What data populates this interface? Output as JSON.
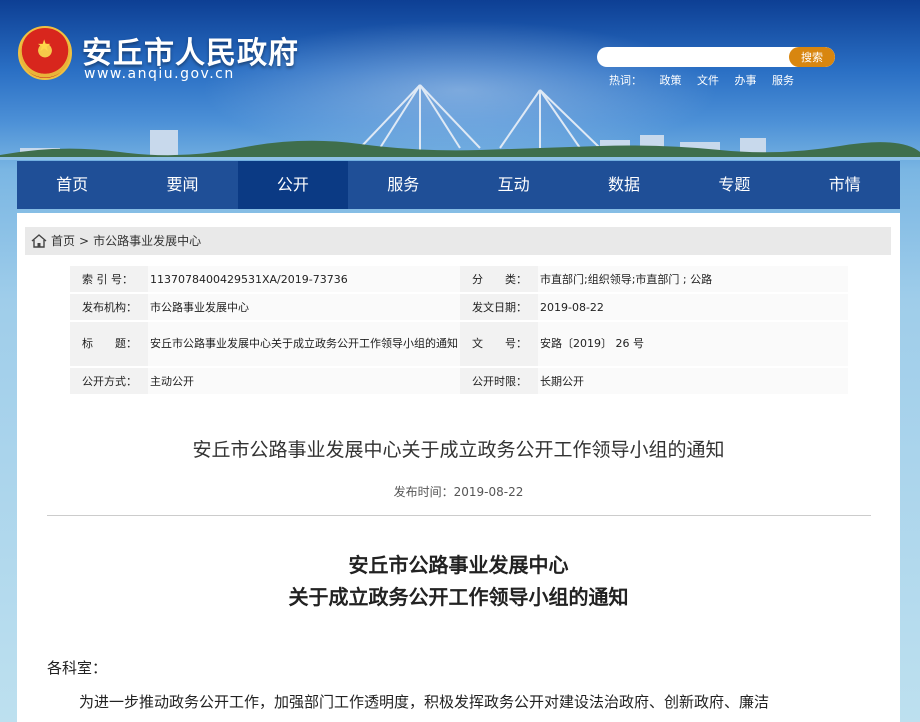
{
  "header": {
    "site_title": "安丘市人民政府",
    "site_url": "www.anqiu.gov.cn",
    "search_placeholder": "",
    "search_button": "搜索",
    "hot_label": "热词：",
    "hot_words": [
      "政策",
      "文件",
      "办事",
      "服务"
    ]
  },
  "nav": [
    "首页",
    "要闻",
    "公开",
    "服务",
    "互动",
    "数据",
    "专题",
    "市情"
  ],
  "nav_active": "公开",
  "breadcrumb": {
    "home": "首页",
    "sep": ">",
    "current": "市公路事业发展中心"
  },
  "meta": {
    "index_label": "索 引 号：",
    "index_value": "1137078400429531XA/2019-73736",
    "category_label": "分　　类：",
    "category_value": "市直部门;组织领导;市直部门 ; 公路",
    "publisher_label": "发布机构：",
    "publisher_value": "市公路事业发展中心",
    "date_label": "发文日期：",
    "date_value": "2019-08-22",
    "title_label": "标　　题：",
    "title_value": "安丘市公路事业发展中心关于成立政务公开工作领导小组的通知",
    "docno_label": "文　　号：",
    "docno_value": "安路〔2019〕 26 号",
    "mode_label": "公开方式：",
    "mode_value": "主动公开",
    "period_label": "公开时限：",
    "period_value": "长期公开"
  },
  "article": {
    "title": "安丘市公路事业发展中心关于成立政务公开工作领导小组的通知",
    "pubtime_label": "发布时间：",
    "pubtime_value": "2019-08-22",
    "doc_title_line1": "安丘市公路事业发展中心",
    "doc_title_line2": "关于成立政务公开工作领导小组的通知",
    "salutation": "各科室：",
    "paragraph1": "为进一步推动政务公开工作，加强部门工作透明度，积极发挥政务公开对建设法治政府、创新政府、廉洁"
  },
  "colors": {
    "nav_bg": "#1f4f97",
    "nav_active": "#0b3a84",
    "search_button": "#d8860f"
  }
}
